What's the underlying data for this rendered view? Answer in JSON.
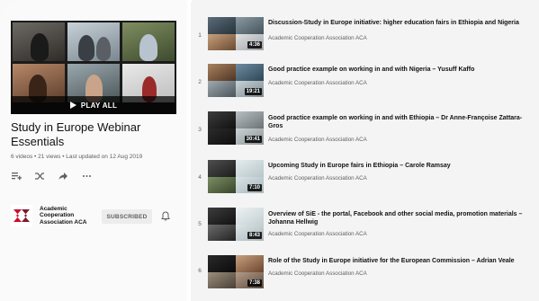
{
  "playlist": {
    "title": "Study in Europe Webinar Essentials",
    "meta": "6 videos • 21 views • Last updated on 12 Aug 2019",
    "play_all_label": "PLAY ALL",
    "owner": {
      "name": "Academic Cooperation Association ACA",
      "subscribe_label": "SUBSCRIBED"
    },
    "icons": [
      "add-to-queue-icon",
      "shuffle-icon",
      "share-icon",
      "more-icon",
      "bell-icon"
    ]
  },
  "videos": [
    {
      "index": "1",
      "title": "Discussion-Study in Europe initiative: higher education fairs in Ethiopia and Nigeria",
      "channel": "Academic Cooperation Association ACA",
      "duration": "4:36"
    },
    {
      "index": "2",
      "title": "Good practice example on working in and with Nigeria – Yusuff Kaffo",
      "channel": "Academic Cooperation Association ACA",
      "duration": "19:21"
    },
    {
      "index": "3",
      "title": "Good practice example on working in and with Ethiopia – Dr Anne-Françoise Zattara-Gros",
      "channel": "Academic Cooperation Association ACA",
      "duration": "30:41"
    },
    {
      "index": "4",
      "title": "Upcoming Study in Europe fairs in Ethiopia – Carole Ramsay",
      "channel": "Academic Cooperation Association ACA",
      "duration": "7:10"
    },
    {
      "index": "5",
      "title": "Overview of SiE - the portal, Facebook and other social media, promotion materials – Johanna Hellwig",
      "channel": "Academic Cooperation Association ACA",
      "duration": "8:43"
    },
    {
      "index": "6",
      "title": "Role of the Study in Europe initiative for the European Commission – Adrian Veale",
      "channel": "Academic Cooperation Association ACA",
      "duration": "7:38"
    }
  ],
  "colors": {
    "text": "#111111",
    "secondary": "#606060",
    "brand_logo": "#c8102e"
  }
}
